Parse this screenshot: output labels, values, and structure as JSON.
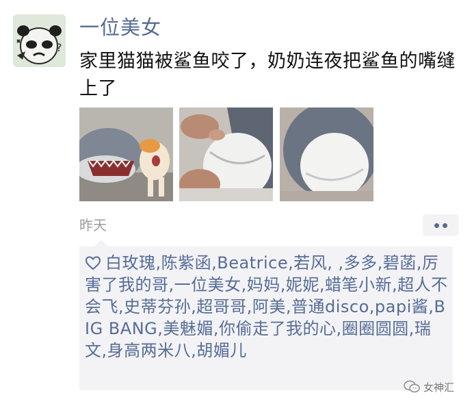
{
  "post": {
    "author": "一位美女",
    "text": "家里猫猫被鲨鱼咬了，奶奶连夜把鲨鱼的嘴缝上了",
    "timestamp": "昨天"
  },
  "likes": {
    "names": "白玫瑰,陈紫函,Beatrice,若风, ,多多,碧菡,厉害了我的哥,一位美女,妈妈,妮妮,蜡笔小新,超人不会飞,史蒂芬孙,超哥哥,阿美,普通disco,papi酱,BIG BANG,美魅媚,你偷走了我的心,圈圈圆圆,瑞文,身高两米八,胡媚儿"
  },
  "icons": {
    "avatar": "panda-meme-avatar",
    "like": "heart-outline-icon",
    "comment": "more-dots-icon",
    "watermark": "wechat-logo-icon"
  },
  "colors": {
    "author": "#556b96",
    "likes_text": "#566c98",
    "likes_bg": "#f3f3f5",
    "timestamp": "#9c9c9c"
  },
  "watermark": {
    "text": "女神汇"
  }
}
